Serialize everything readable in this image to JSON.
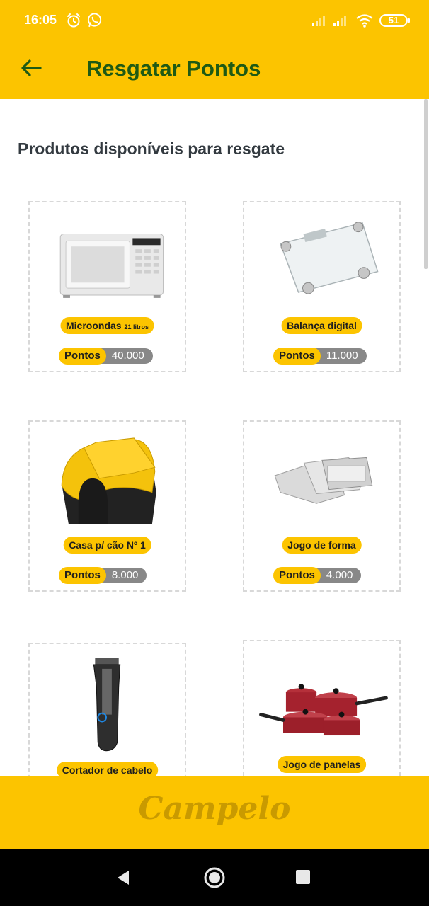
{
  "status_bar": {
    "time": "16:05",
    "battery": "51"
  },
  "app_bar": {
    "title": "Resgatar Pontos"
  },
  "section": {
    "title": "Produtos disponíveis para resgate"
  },
  "products": [
    {
      "name": "Microondas",
      "name_suffix": "21 litros",
      "points_label": "Pontos",
      "points": "40.000"
    },
    {
      "name": "Balança digital",
      "name_suffix": "",
      "points_label": "Pontos",
      "points": "11.000"
    },
    {
      "name": "Casa p/ cão Nº 1",
      "name_suffix": "",
      "points_label": "Pontos",
      "points": "8.000"
    },
    {
      "name": "Jogo de forma",
      "name_suffix": "",
      "points_label": "Pontos",
      "points": "4.000"
    },
    {
      "name": "Cortador de cabelo",
      "name_suffix": ""
    },
    {
      "name": "Jogo de panelas",
      "name_suffix": ""
    }
  ],
  "footer": {
    "brand": "Campelo"
  },
  "colors": {
    "brand_yellow": "#FCC400",
    "title_green": "#1F5A14",
    "points_gray": "#888888"
  }
}
